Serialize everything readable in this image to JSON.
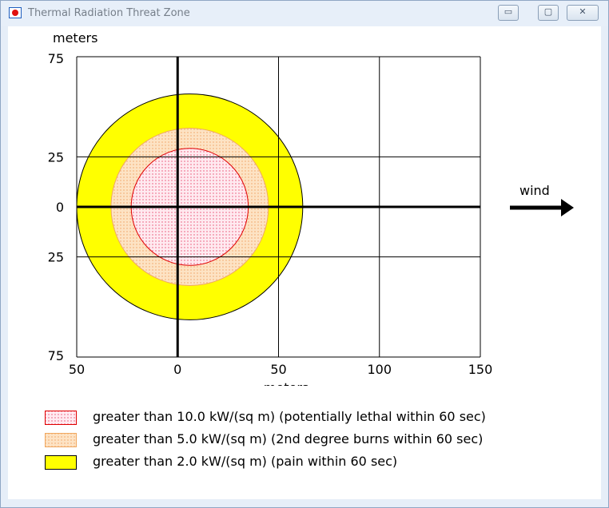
{
  "window": {
    "title": "Thermal Radiation Threat Zone",
    "minimize_label": "▭",
    "maximize_label": "▢",
    "close_label": "✕"
  },
  "chart_data": {
    "type": "threat-zone",
    "title": "",
    "xlabel": "meters",
    "ylabel": "meters",
    "xlim": [
      -50,
      150
    ],
    "ylim": [
      -75,
      75
    ],
    "x_ticks": [
      -50,
      0,
      50,
      100,
      150
    ],
    "x_tick_labels": [
      "50",
      "0",
      "50",
      "100",
      "150"
    ],
    "y_ticks": [
      75,
      25,
      0,
      -25,
      -75
    ],
    "y_tick_labels": [
      "75",
      "25",
      "0",
      "25",
      "75"
    ],
    "grid": true,
    "wind_label": "wind",
    "zones": [
      {
        "name": "greater than 2.0 kW/(sq m) (pain within 60 sec)",
        "center_x": 6,
        "radius": 56,
        "fill": "#ffff00",
        "stroke": "#000000",
        "pattern": "solid"
      },
      {
        "name": "greater than 5.0 kW/(sq m) (2nd degree burns within 60 sec)",
        "center_x": 6,
        "radius": 39,
        "fill": "#fde3c4",
        "stroke": "#f0a860",
        "pattern": "dotted-orange"
      },
      {
        "name": "greater than 10.0 kW/(sq m) (potentially lethal within 60 sec)",
        "center_x": 6,
        "radius": 29,
        "fill": "#ffeaf0",
        "stroke": "#e00000",
        "pattern": "dotted-red"
      }
    ]
  },
  "legend": {
    "items": [
      {
        "label": "greater than 10.0 kW/(sq m) (potentially lethal within 60 sec)",
        "swatch": "dotted-red",
        "border": "#e00000"
      },
      {
        "label": "greater than 5.0 kW/(sq m) (2nd degree burns within 60 sec)",
        "swatch": "dotted-orange",
        "border": "#f0a860"
      },
      {
        "label": "greater than 2.0 kW/(sq m) (pain within 60 sec)",
        "swatch": "solid-yellow",
        "border": "#000000"
      }
    ]
  }
}
